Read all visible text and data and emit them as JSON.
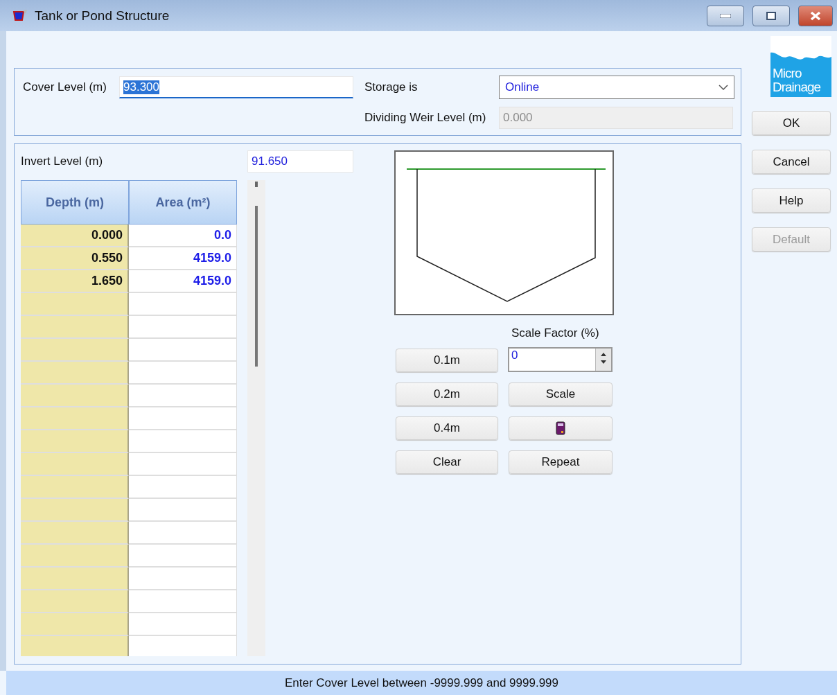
{
  "window": {
    "title": "Tank or Pond Structure"
  },
  "cover_level": {
    "label": "Cover Level (m)",
    "value": "93.300",
    "text_selected": true
  },
  "storage": {
    "label": "Storage is",
    "value": "Online"
  },
  "dividing_weir": {
    "label": "Dividing Weir Level (m)",
    "value": "0.000",
    "disabled": true
  },
  "invert_level": {
    "label": "Invert Level (m)",
    "value": "91.650"
  },
  "table": {
    "columns": [
      "Depth (m)",
      "Area (m²)"
    ],
    "rows": [
      [
        "0.000",
        "0.0"
      ],
      [
        "0.550",
        "4159.0"
      ],
      [
        "1.650",
        "4159.0"
      ]
    ]
  },
  "scale_factor": {
    "label": "Scale Factor (%)",
    "value": "0"
  },
  "step_buttons": [
    "0.1m",
    "0.2m",
    "0.4m",
    "Clear"
  ],
  "action_buttons": [
    {
      "kind": "text",
      "label": "Scale"
    },
    {
      "kind": "calculator"
    },
    {
      "kind": "text",
      "label": "Repeat"
    }
  ],
  "logo": {
    "lines": [
      "Micro",
      "Drainage"
    ]
  },
  "dialog_buttons": [
    {
      "label": "OK",
      "disabled": false
    },
    {
      "label": "Cancel",
      "disabled": false
    },
    {
      "label": "Help",
      "disabled": false
    },
    {
      "label": "Default",
      "disabled": true
    }
  ],
  "status_bar": "Enter Cover Level between -9999.999 and 9999.999"
}
